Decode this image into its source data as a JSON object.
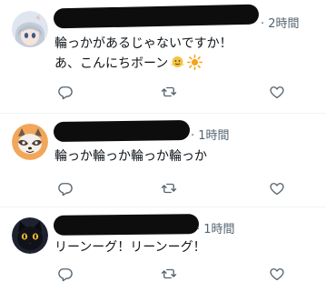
{
  "colors": {
    "text": "#0f1419",
    "muted": "#536471",
    "divider": "#eff3f4",
    "redaction": "#0d0d0d"
  },
  "tweets": [
    {
      "time": "· 2時間",
      "lines": [
        "輪っかがあるじゃないですか！",
        "あ、こんにちボーン"
      ],
      "emojis": [
        "shrug-emoji",
        "sun-emoji"
      ],
      "avatar": "anime-girl-avatar"
    },
    {
      "time": "· 1時間",
      "lines": [
        "輪っか輪っか輪っか輪っか"
      ],
      "avatar": "raccoon-avatar"
    },
    {
      "time": "· 1時間",
      "lines": [
        "リーンーグ！リーンーグ！"
      ],
      "avatar": "black-cat-avatar"
    }
  ],
  "action_icons": [
    "reply-icon",
    "retweet-icon",
    "like-icon"
  ]
}
